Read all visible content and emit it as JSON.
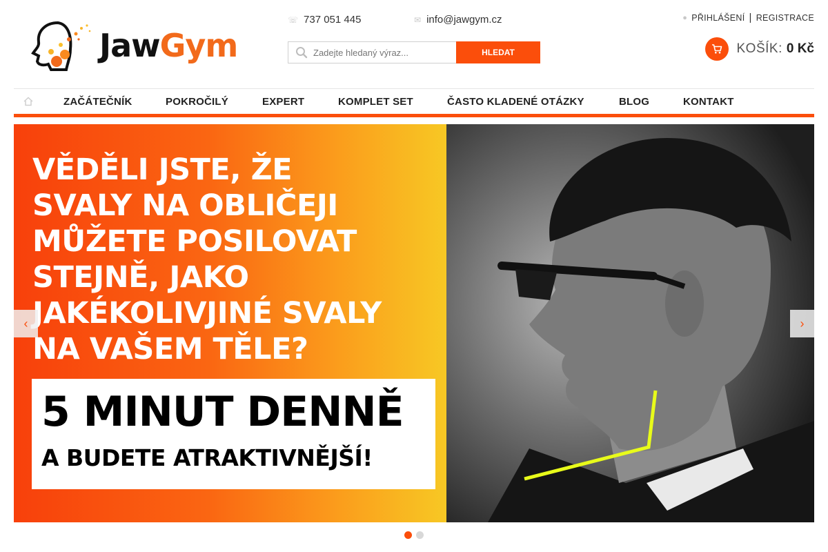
{
  "logo": {
    "text_part1": "Jaw",
    "text_part2": "Gym",
    "icon": "head-silhouette-logo-icon"
  },
  "header": {
    "phone": "737 051 445",
    "email": "info@jawgym.cz",
    "phone_icon": "phone-icon",
    "email_icon": "envelope-icon"
  },
  "search": {
    "placeholder": "Zadejte hledaný výraz...",
    "button_label": "HLEDAT",
    "icon": "search-icon"
  },
  "account": {
    "login_label": "PŘIHLÁŠENÍ",
    "separator": "|",
    "register_label": "REGISTRACE",
    "icon": "user-icon"
  },
  "cart": {
    "label": "KOŠÍK:",
    "amount": "0 Kč",
    "icon": "shopping-cart-icon"
  },
  "nav": {
    "home_icon": "home-icon",
    "items": [
      {
        "label": "ZAČÁTEČNÍK"
      },
      {
        "label": "POKROČILÝ"
      },
      {
        "label": "EXPERT"
      },
      {
        "label": "KOMPLET SET"
      },
      {
        "label": "ČASTO KLADENÉ OTÁZKY"
      },
      {
        "label": "BLOG"
      },
      {
        "label": "KONTAKT"
      }
    ]
  },
  "banner": {
    "headline_lines": [
      "VĚDĚLI JSTE, ŽE",
      "SVALY NA OBLIČEJI",
      "MŮŽETE POSILOVAT",
      "STEJNĚ, JAKO",
      "JAKÉKOLIVJINÉ SVALY",
      "NA VAŠEM TĚLE?"
    ],
    "promo_big": "5 MINUT DENNĚ",
    "promo_small": "A BUDETE ATRAKTIVNĚJŠÍ!",
    "prev_icon": "chevron-left-icon",
    "next_icon": "chevron-right-icon",
    "slide_count": 2,
    "active_slide": 1
  },
  "colors": {
    "accent": "#fb4e0b",
    "brand_orange": "#f26a1b",
    "jaw_line": "#e8fb1a"
  }
}
